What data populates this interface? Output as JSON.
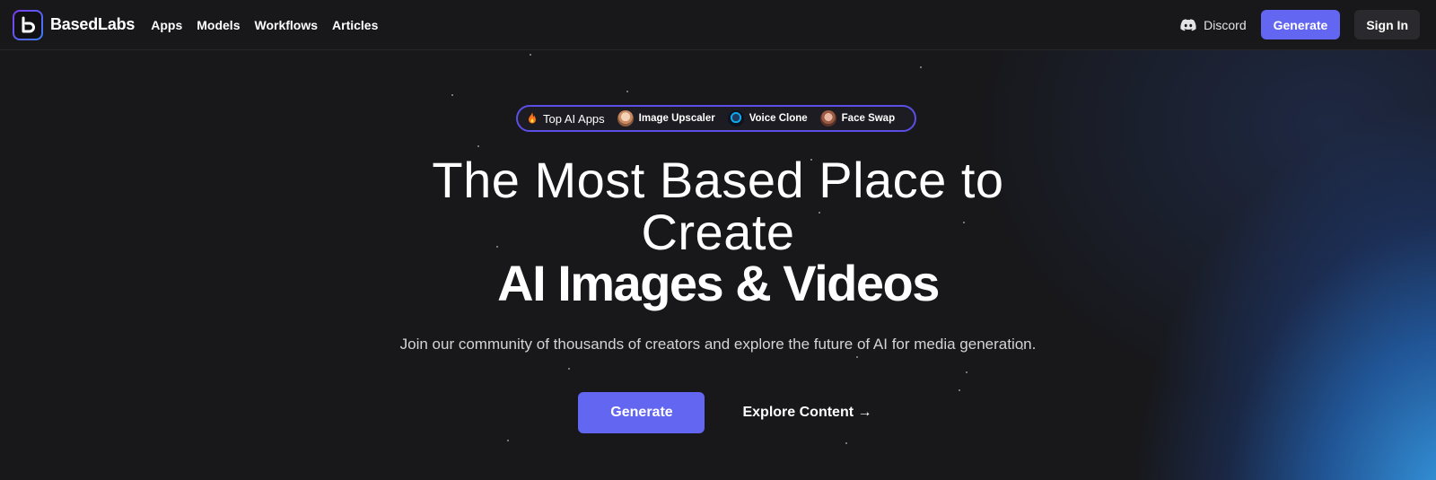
{
  "brand": {
    "name": "BasedLabs"
  },
  "nav": {
    "items": [
      {
        "label": "Apps"
      },
      {
        "label": "Models"
      },
      {
        "label": "Workflows"
      },
      {
        "label": "Articles"
      }
    ]
  },
  "header": {
    "discord_label": "Discord",
    "generate_label": "Generate",
    "signin_label": "Sign In"
  },
  "top_apps": {
    "title": "Top AI Apps",
    "title_icon": "fire-icon",
    "apps": [
      {
        "label": "Image Upscaler"
      },
      {
        "label": "Voice Clone"
      },
      {
        "label": "Face Swap"
      }
    ]
  },
  "hero": {
    "line1": "The Most Based Place to",
    "line2": "Create",
    "line3": "AI Images & Videos",
    "subtitle": "Join our community of thousands of creators and explore the future of AI for media generation.",
    "cta_primary": "Generate",
    "cta_secondary": "Explore Content →"
  },
  "colors": {
    "accent": "#6366f1",
    "background": "#18181b",
    "pill_border": "#5b4ee6",
    "glow": "#38a0eb"
  }
}
